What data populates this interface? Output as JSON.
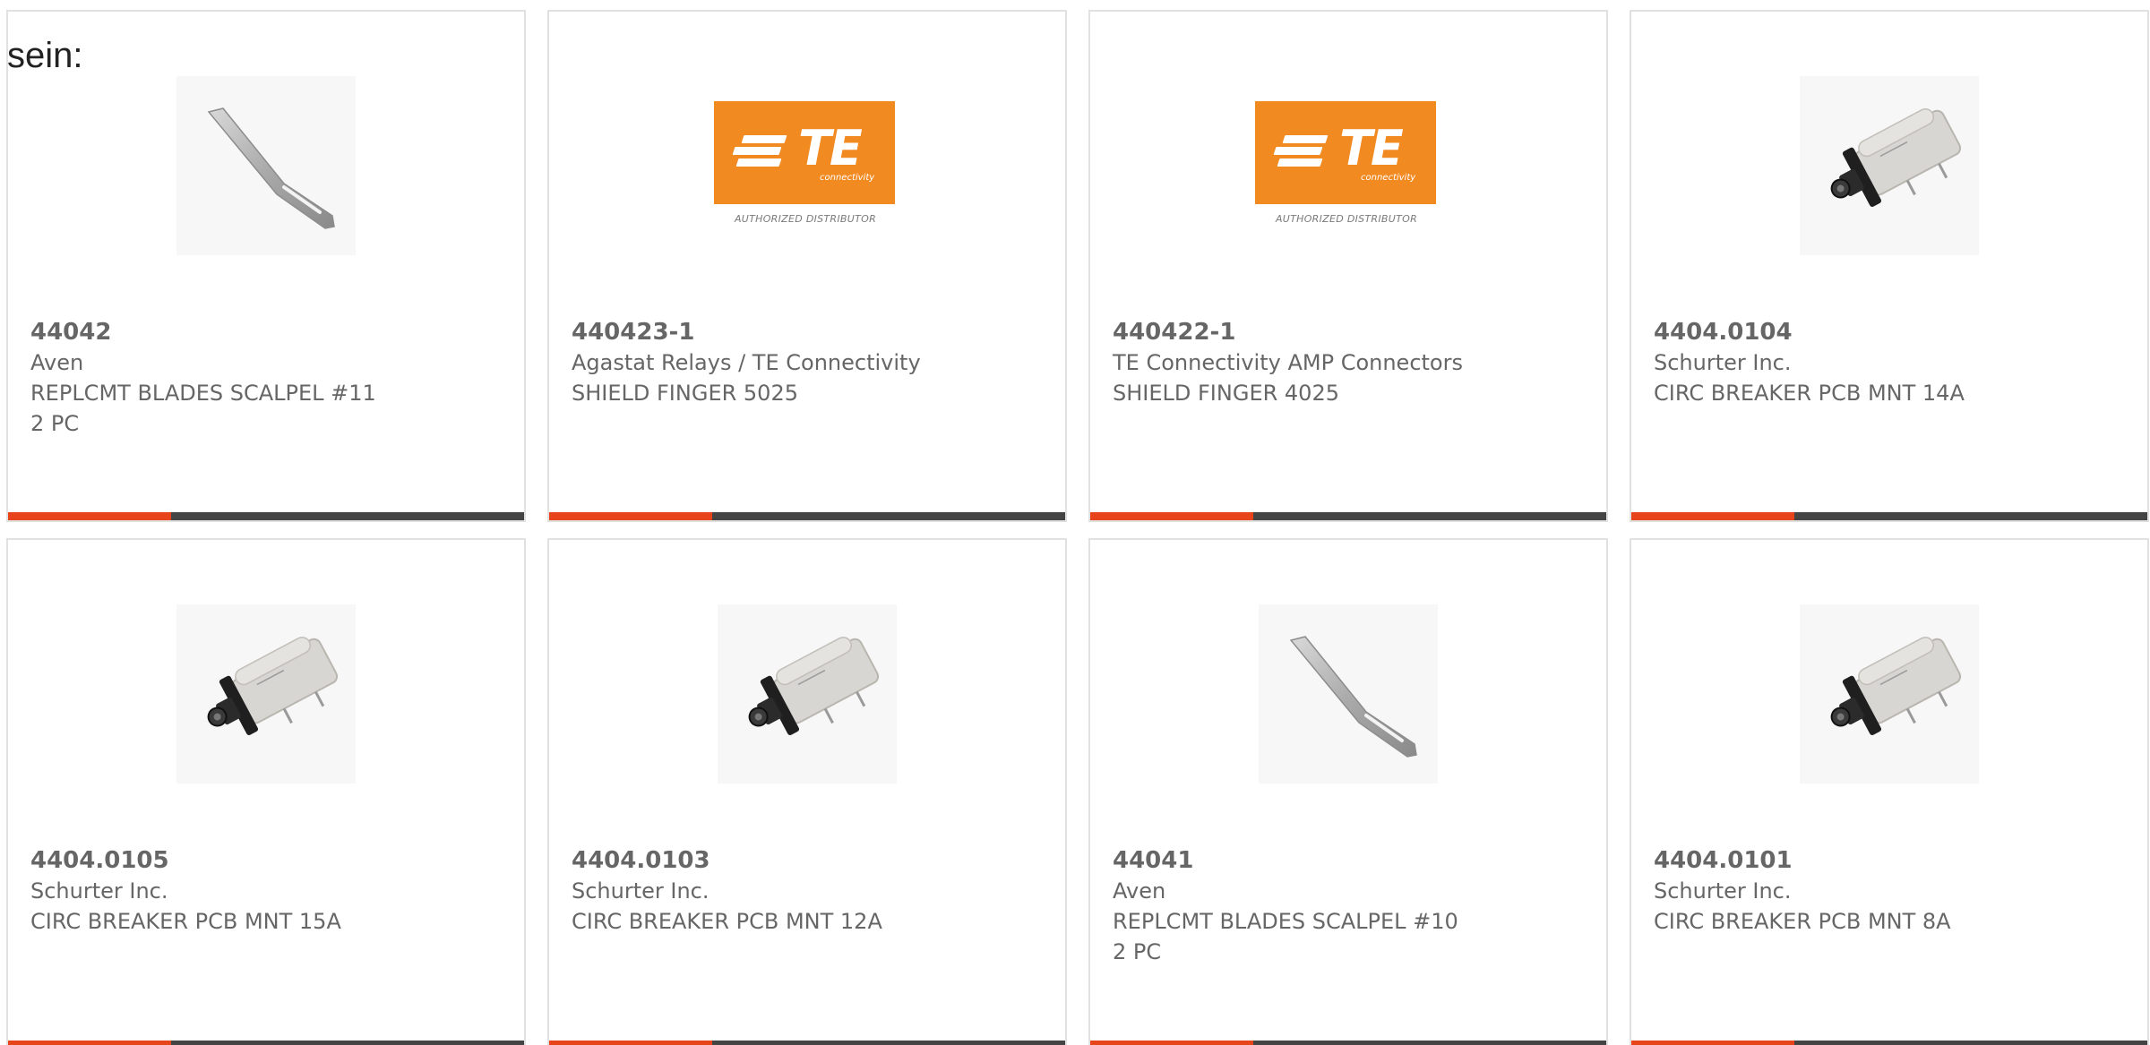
{
  "leading_text": "sein:",
  "brand_colors": {
    "te_orange": "#f28a22",
    "accent_bar": "#e8441c",
    "bar_dark": "#444444",
    "text_gray": "#666666"
  },
  "te_logo": {
    "mark": "TE",
    "sub": "connectivity",
    "caption": "AUTHORIZED DISTRIBUTOR"
  },
  "products": [
    {
      "part_number": "44042",
      "manufacturer": "Aven",
      "description": "REPLCMT BLADES SCALPEL #11",
      "extra": "2 PC",
      "image": "scalpel-blade-icon"
    },
    {
      "part_number": "440423-1",
      "manufacturer": "Agastat Relays / TE Connectivity",
      "description": "SHIELD FINGER 5025",
      "extra": "",
      "image": "te-connectivity-logo"
    },
    {
      "part_number": "440422-1",
      "manufacturer": "TE Connectivity AMP Connectors",
      "description": "SHIELD FINGER 4025",
      "extra": "",
      "image": "te-connectivity-logo"
    },
    {
      "part_number": "4404.0104",
      "manufacturer": "Schurter Inc.",
      "description": "CIRC BREAKER PCB MNT 14A",
      "extra": "",
      "image": "circuit-breaker-icon"
    },
    {
      "part_number": "4404.0105",
      "manufacturer": "Schurter Inc.",
      "description": "CIRC BREAKER PCB MNT 15A",
      "extra": "",
      "image": "circuit-breaker-icon"
    },
    {
      "part_number": "4404.0103",
      "manufacturer": "Schurter Inc.",
      "description": "CIRC BREAKER PCB MNT 12A",
      "extra": "",
      "image": "circuit-breaker-icon"
    },
    {
      "part_number": "44041",
      "manufacturer": "Aven",
      "description": "REPLCMT BLADES SCALPEL #10",
      "extra": "2 PC",
      "image": "scalpel-blade-icon"
    },
    {
      "part_number": "4404.0101",
      "manufacturer": "Schurter Inc.",
      "description": "CIRC BREAKER PCB MNT 8A",
      "extra": "",
      "image": "circuit-breaker-icon"
    }
  ]
}
